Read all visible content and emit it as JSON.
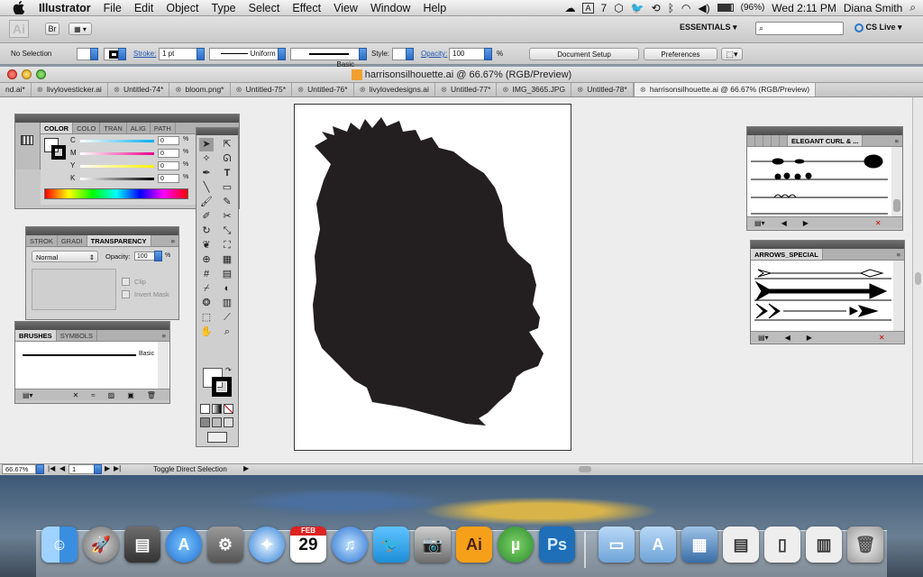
{
  "menubar": {
    "app_name": "Illustrator",
    "items": [
      "File",
      "Edit",
      "Object",
      "Type",
      "Select",
      "Effect",
      "View",
      "Window",
      "Help"
    ],
    "status_number": "7",
    "battery": "(96%)",
    "clock": "Wed 2:11 PM",
    "user": "Diana Smith"
  },
  "appbar": {
    "logo": "Ai",
    "br": "Br",
    "workspace": "ESSENTIALS",
    "cs_live": "CS Live"
  },
  "control": {
    "selection": "No Selection",
    "stroke_label": "Stroke:",
    "stroke_value": "1 pt",
    "profile": "Uniform",
    "brush": "Basic",
    "style_label": "Style:",
    "opacity_label": "Opacity:",
    "opacity_value": "100",
    "percent": "%",
    "doc_setup": "Document Setup",
    "preferences": "Preferences"
  },
  "document": {
    "title": "harrisonsilhouette.ai @ 66.67% (RGB/Preview)",
    "tabs": [
      {
        "label": "nd.ai*"
      },
      {
        "label": "livylovesticker.ai"
      },
      {
        "label": "Untitled-74*"
      },
      {
        "label": "bloom.png*"
      },
      {
        "label": "Untitled-75*"
      },
      {
        "label": "Untitled-76*"
      },
      {
        "label": "livylovedesigns.ai"
      },
      {
        "label": "Untitled-77*"
      },
      {
        "label": "IMG_3665.JPG"
      },
      {
        "label": "Untitled-78*"
      },
      {
        "label": "harrisonsilhouette.ai @ 66.67% (RGB/Preview)"
      }
    ]
  },
  "status": {
    "zoom": "66.67%",
    "page": "1",
    "tool": "Toggle Direct Selection"
  },
  "color_panel": {
    "tabs": [
      "COLOR",
      "COLO",
      "TRAN",
      "ALIG",
      "PATH"
    ],
    "channels": [
      {
        "label": "C",
        "value": "0"
      },
      {
        "label": "M",
        "value": "0"
      },
      {
        "label": "Y",
        "value": "0"
      },
      {
        "label": "K",
        "value": "0"
      }
    ],
    "percent": "%"
  },
  "transparency_panel": {
    "tabs": [
      "STROK",
      "GRADI",
      "TRANSPARENCY"
    ],
    "blend_mode": "Normal",
    "opacity_label": "Opacity:",
    "opacity_value": "100",
    "percent": "%",
    "clip": "Clip",
    "invert_mask": "Invert Mask"
  },
  "brushes_panel": {
    "tabs": [
      "BRUSHES",
      "SYMBOLS"
    ],
    "brush_name": "Basic"
  },
  "elegant_panel": {
    "title": "ELEGANT CURL & ..."
  },
  "arrows_panel": {
    "title": "ARROWS_SPECIAL"
  },
  "dock": {
    "calendar_month": "FEB",
    "calendar_day": "29",
    "ai_label": "Ai",
    "ps_label": "Ps"
  }
}
